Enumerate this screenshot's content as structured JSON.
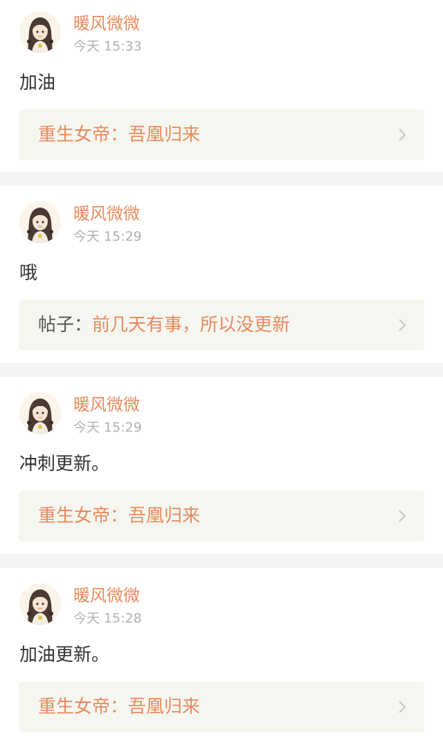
{
  "colors": {
    "accent": "#e68a5c",
    "timestamp": "#b0b0b0",
    "body_text": "#333333",
    "link_box_bg": "#f6f6f1",
    "page_bg": "#f4f4f4"
  },
  "comments": [
    {
      "username": "暖风微微",
      "time": "今天 15:33",
      "text": "加油",
      "link": {
        "prefix": "重生女帝：",
        "title": "吾凰归来",
        "icon": "chevron-right-icon"
      }
    },
    {
      "username": "暖风微微",
      "time": "今天 15:29",
      "text": "哦",
      "link": {
        "prefix": "帖子：",
        "title": "前几天有事，所以没更新",
        "icon": "chevron-right-icon"
      }
    },
    {
      "username": "暖风微微",
      "time": "今天 15:29",
      "text": "冲刺更新。",
      "link": {
        "prefix": "重生女帝：",
        "title": "吾凰归来",
        "icon": "chevron-right-icon"
      }
    },
    {
      "username": "暖风微微",
      "time": "今天 15:28",
      "text": "加油更新。",
      "link": {
        "prefix": "重生女帝：",
        "title": "吾凰归来",
        "icon": "chevron-right-icon"
      }
    }
  ]
}
